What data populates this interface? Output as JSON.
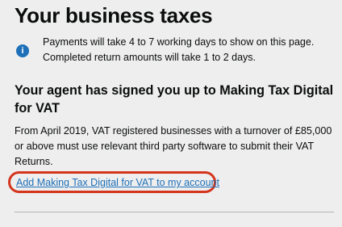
{
  "page": {
    "title": "Your business taxes"
  },
  "notice": {
    "icon": "info-icon",
    "icon_glyph": "i",
    "line1": "Payments will take 4 to 7 working days to show on this page.",
    "line2": "Completed return amounts will take 1 to 2 days."
  },
  "mtd": {
    "heading": "Your agent has signed you up to Making Tax Digital for VAT",
    "body": "From April 2019, VAT registered businesses with a turnover of £85,000 or above must use relevant third party software to submit their VAT Returns.",
    "link_label": "Add Making Tax Digital for VAT to my account"
  },
  "colors": {
    "background": "#eeeeee",
    "text": "#0b0c0c",
    "link": "#1d70b8",
    "info_icon": "#1d70b8",
    "highlight": "#d4351c",
    "divider": "#b1b4b6"
  }
}
